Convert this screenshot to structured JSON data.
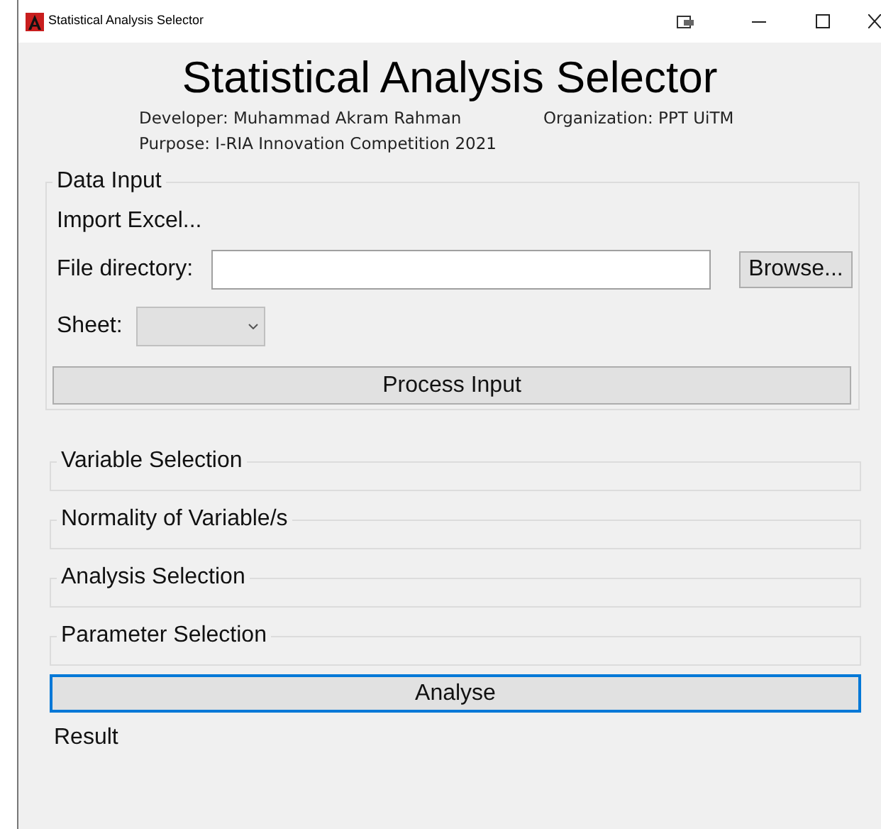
{
  "window": {
    "title": "Statistical Analysis Selector"
  },
  "header": {
    "title": "Statistical Analysis Selector",
    "developer": "Developer: Muhammad Akram Rahman",
    "organization": "Organization: PPT UiTM",
    "purpose": "Purpose: I-RIA Innovation Competition 2021"
  },
  "data_input": {
    "legend": "Data Input",
    "import_label": "Import Excel...",
    "file_label": "File directory:",
    "browse_button": "Browse...",
    "sheet_label": "Sheet:",
    "process_button": "Process Input"
  },
  "sections": [
    {
      "legend": "Variable Selection"
    },
    {
      "legend": "Normality of Variable/s"
    },
    {
      "legend": "Analysis Selection"
    },
    {
      "legend": "Parameter Selection"
    }
  ],
  "analyse_button": {
    "label": "Analyse",
    "focused": true
  },
  "result_label": "Result"
}
